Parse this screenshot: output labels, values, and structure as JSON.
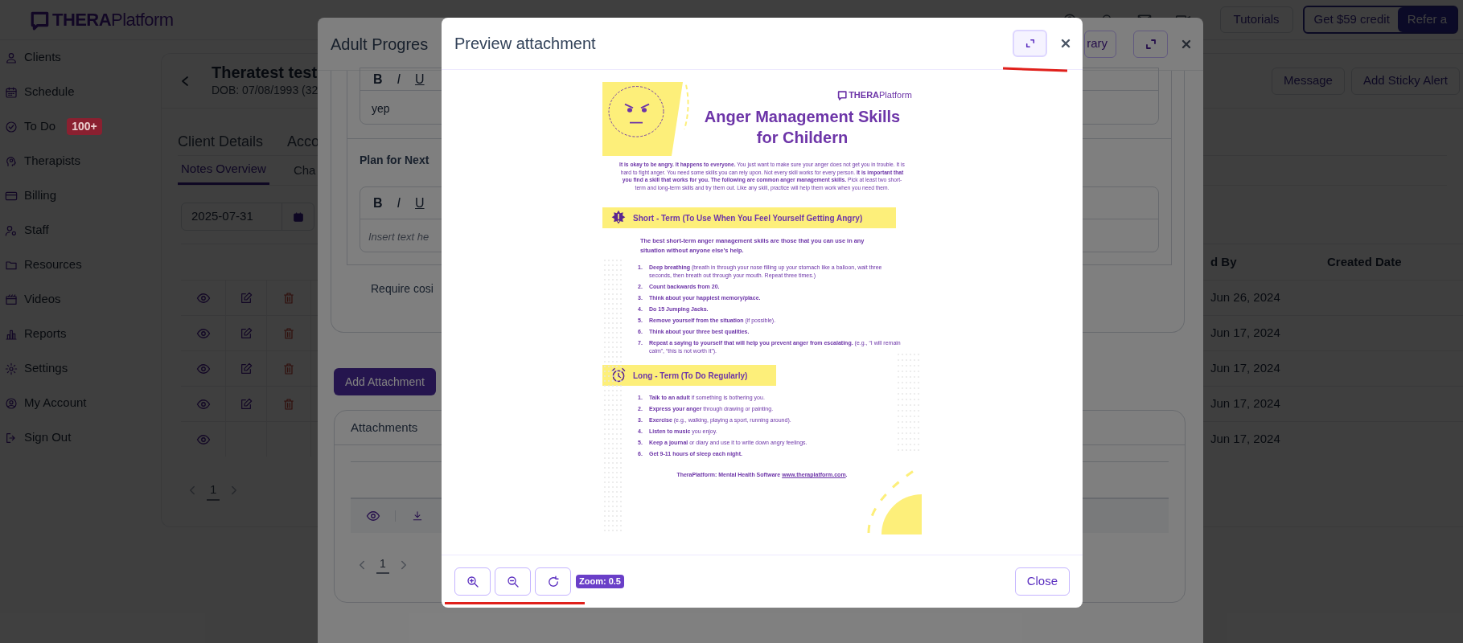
{
  "header": {
    "logo": "**THERA**Platform",
    "tutorials": "Tutorials",
    "credit": "Get $59 credit",
    "refer": "Refer a"
  },
  "sidebar": {
    "items": [
      {
        "label": "Clients"
      },
      {
        "label": "Schedule"
      },
      {
        "label": "To Do",
        "badge": "100+"
      },
      {
        "label": "Therapists"
      },
      {
        "label": "Billing"
      },
      {
        "label": "Staff"
      },
      {
        "label": "Resources"
      },
      {
        "label": "Videos"
      },
      {
        "label": "Reports"
      },
      {
        "label": "Settings"
      },
      {
        "label": "My Account"
      },
      {
        "label": "Sign Out"
      }
    ]
  },
  "client": {
    "name": "Theratest test",
    "dob": "DOB: 07/08/1993 (32",
    "actions": [
      "Message",
      "Add Sticky Alert"
    ],
    "tabs": [
      "Client Details",
      "Acco"
    ],
    "subtabs": [
      {
        "label": "Notes Overview",
        "selected": true
      },
      {
        "label": "Cha",
        "selected": false
      }
    ],
    "date": "2025-07-31",
    "table": {
      "columns": [
        "d By",
        "Created Date"
      ],
      "rows": [
        {
          "editable": true,
          "date": "Jun 26, 2024"
        },
        {
          "editable": true,
          "date": "Jun 17, 2024"
        },
        {
          "editable": true,
          "date": "Jun 17, 2024"
        },
        {
          "editable": true,
          "date": "Jun 17, 2024"
        },
        {
          "editable": false,
          "date": "Jun 17, 2024"
        }
      ]
    },
    "page": "1"
  },
  "progress_note": {
    "title": "Adult Progres",
    "library": "rary",
    "toolbar": [
      "B",
      "I",
      "U"
    ],
    "answer": "yep",
    "plan_label": "Plan for Next",
    "plan_toolbar": [
      "B",
      "I",
      "U"
    ],
    "plan_placeholder": "Insert text he",
    "cosign": "Require cosi",
    "add_attachment": "Add Attachment",
    "attachments_title": "Attachments",
    "page": "1"
  },
  "preview": {
    "title": "Preview attachment",
    "document": {
      "logo": "**THERA**Platform",
      "title": "Anger Management Skills for Childern",
      "intro": "**It is okay to be angry. It happens to everyone.** You just want to make sure your anger does not get you in trouble. It is hard to fight anger. You need some skills you can rely upon. Not every skill works for every person. **It is important that you find a skill that works for you. The following are common anger management skills.** Pick at least two short-term and long-term skills and try them out. Like any skill, practice will help them work when you need them.",
      "sections": [
        {
          "heading": "Short - Term (To Use When You Feel Yourself Getting Angry)",
          "lead": "The best short-term anger management skills are those that you can use in any situation without anyone else’s help.",
          "items": [
            {
              "number": "1.",
              "text": "**Deep breathing** (breath in through your nose filling up your stomach like a balloon, wait three seconds, then breath out through your mouth. Repeat three times.)"
            },
            {
              "number": "2.",
              "text": "**Count backwards from 20.**"
            },
            {
              "number": "3.",
              "text": "**Think about your happiest memory/place.**"
            },
            {
              "number": "4.",
              "text": "**Do 15 Jumping Jacks.**"
            },
            {
              "number": "5.",
              "text": "**Remove yourself from the situation** (if possible)."
            },
            {
              "number": "6.",
              "text": "**Think about your three best qualities.**"
            },
            {
              "number": "7.",
              "text": "**Repeat a saying to yourself that will help you prevent anger from escalating.** (e.g., “I will remain calm”, “this is not worth it”)."
            }
          ]
        },
        {
          "heading": "Long - Term (To Do Regularly)",
          "items": [
            {
              "number": "1.",
              "text": "**Talk to an adult** if something is bothering you."
            },
            {
              "number": "2.",
              "text": "**Express your anger** through drawing or painting."
            },
            {
              "number": "3.",
              "text": "**Exercise** (e.g., walking, playing a sport, running around)."
            },
            {
              "number": "4.",
              "text": "**Listen to music** you enjoy."
            },
            {
              "number": "5.",
              "text": "**Keep a journal** or diary and use it to write down angry feelings."
            },
            {
              "number": "6.",
              "text": "**Get 9-11 hours of sleep each night.**"
            }
          ]
        }
      ],
      "footer": "TheraPlatform: Mental Health Software",
      "footer_link": "www.theraplatform.com",
      "footer_end": "."
    },
    "zoom": "Zoom: 0.5",
    "close": "Close"
  }
}
